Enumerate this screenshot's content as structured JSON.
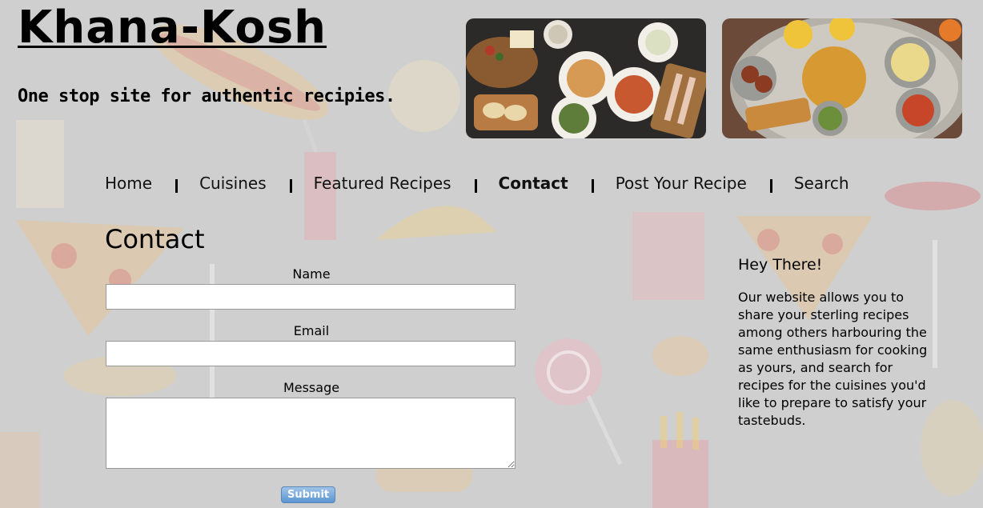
{
  "site": {
    "title": "Khana-Kosh",
    "tagline": "One stop site for authentic recipies."
  },
  "nav": {
    "items": [
      {
        "label": "Home",
        "active": false
      },
      {
        "label": "Cuisines",
        "active": false
      },
      {
        "label": "Featured Recipes",
        "active": false
      },
      {
        "label": "Contact",
        "active": true
      },
      {
        "label": "Post Your Recipe",
        "active": false
      },
      {
        "label": "Search",
        "active": false
      }
    ]
  },
  "contact": {
    "heading": "Contact",
    "name_label": "Name",
    "name_value": "",
    "email_label": "Email",
    "email_value": "",
    "message_label": "Message",
    "message_value": "",
    "submit_label": "Submit"
  },
  "aside": {
    "title": "Hey There!",
    "text": "Our website allows you to share your sterling recipes among others harbouring the same enthusiasm for cooking as yours, and search for recipes for the cuisines you'd like to prepare to satisfy your tastebuds."
  },
  "images": [
    {
      "name": "food-spread-image"
    },
    {
      "name": "indian-thali-image"
    }
  ],
  "colors": {
    "background": "#cfcfcf",
    "submit_button": "#5b95d1"
  }
}
